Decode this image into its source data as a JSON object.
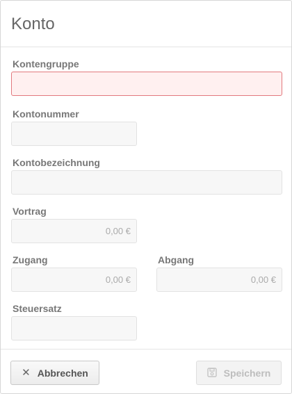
{
  "dialog": {
    "title": "Konto"
  },
  "fields": {
    "kontengruppe": {
      "label": "Kontengruppe",
      "value": ""
    },
    "kontonummer": {
      "label": "Kontonummer",
      "value": ""
    },
    "kontobezeichnung": {
      "label": "Kontobezeichnung",
      "value": ""
    },
    "vortrag": {
      "label": "Vortrag",
      "value": "0,00 €"
    },
    "zugang": {
      "label": "Zugang",
      "value": "0,00 €"
    },
    "abgang": {
      "label": "Abgang",
      "value": "0,00 €"
    },
    "steuersatz": {
      "label": "Steuersatz",
      "value": ""
    }
  },
  "footer": {
    "cancel_label": "Abbrechen",
    "save_label": "Speichern",
    "cancel_icon": "close-icon",
    "save_icon": "floppy-disk-icon"
  },
  "colors": {
    "error_border": "#e2787d",
    "error_background": "#fff0f0"
  }
}
